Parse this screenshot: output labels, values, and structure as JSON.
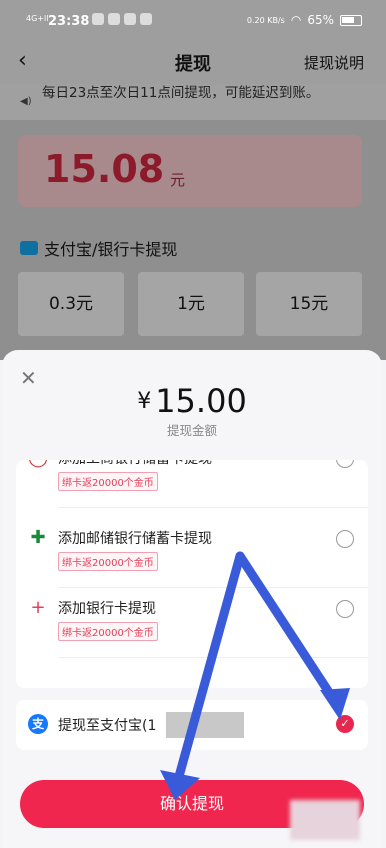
{
  "status": {
    "time": "23:38",
    "signal": "4G+ll",
    "net_speed": "0.20 KB/s",
    "battery": "65%"
  },
  "header": {
    "title": "提现",
    "explain_label": "提现说明"
  },
  "notice": "每日23点至次日11点间提现，可能延迟到账。",
  "balance": {
    "amount": "15.08",
    "unit": "元"
  },
  "methods_title": "支付宝/银行卡提现",
  "amount_options": [
    "0.3元",
    "1元",
    "15元"
  ],
  "sheet": {
    "amount": "15.00",
    "currency": "¥",
    "label": "提现金额",
    "options": [
      {
        "label": "添加工商银行储蓄卡提现",
        "tag": "绑卡返20000个金币"
      },
      {
        "label": "添加邮储银行储蓄卡提现",
        "tag": "绑卡返20000个金币"
      },
      {
        "label": "添加银行卡提现",
        "tag": "绑卡返20000个金币"
      }
    ],
    "selected": {
      "label": "提现至支付宝(1",
      "suffix": ")"
    },
    "confirm_label": "确认提现"
  },
  "colors": {
    "accent": "#f0264e",
    "alipay": "#1677ff",
    "annotation_arrow": "#3a5bd9"
  }
}
